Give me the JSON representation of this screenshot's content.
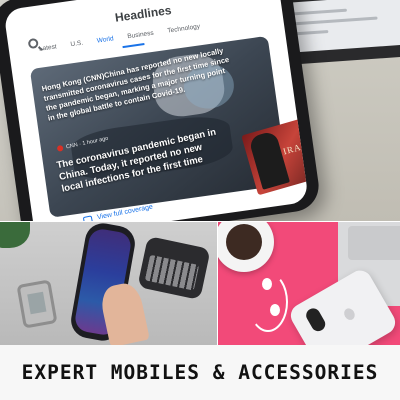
{
  "news_app": {
    "title": "Headlines",
    "tabs": [
      "Latest",
      "U.S.",
      "World",
      "Business",
      "Technology"
    ],
    "active_tab": "World",
    "headline_1": "Hong Kong (CNN)China has reported no new locally transmitted coronavirus cases for the first time since the pandemic began, marking a major turning point in the global battle to contain Covid-19.",
    "byline": "CNN · 1 hour ago",
    "headline_2": "The coronavirus pandemic began in China. Today, it reported no new local infections for the first time",
    "coverage_link": "View full coverage",
    "magazine_title": "IRAN",
    "accent_color": "#1a73e8"
  },
  "caption": "EXPERT MOBILES & ACCESSORIES",
  "icons": [
    "search-icon",
    "coverage-icon"
  ]
}
